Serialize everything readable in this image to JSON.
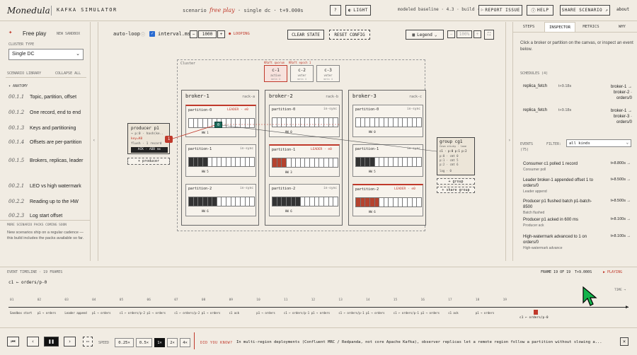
{
  "topbar": {
    "logo": "Monedula",
    "app_name": "KAFKA SIMULATOR",
    "scenario_prefix": "scenario",
    "scenario_name": "free play",
    "scenario_suffix": "· single dc · t+9.000s",
    "help_label": "?",
    "theme_label": "LIGHT",
    "build": "modeled baseline · 4.3 · build · 1.2.0",
    "report_issue": "REPORT ISSUE",
    "help": "HELP",
    "share": "SHARE SCENARIO ↗",
    "about": "about"
  },
  "left": {
    "tab_label": "Free play",
    "new_sandbox": "NEW SANDBOX",
    "cluster_type_label": "CLUSTER TYPE",
    "cluster_type_value": "Single DC",
    "library_label": "SCENARIO LIBRARY",
    "collapse_all": "COLLAPSE ALL",
    "section": "ANATOMY",
    "lessons": [
      {
        "num": "00.1.1",
        "title": "Topic, partition, offset"
      },
      {
        "num": "00.1.2",
        "title": "One record, end to end"
      },
      {
        "num": "00.1.3",
        "title": "Keys and partitioning"
      },
      {
        "num": "00.1.4",
        "title": "Offsets are per-partition"
      },
      {
        "num": "00.1.5",
        "title": "Brokers, replicas, leader"
      },
      {
        "num": "00.2.1",
        "title": "LEO vs high watermark"
      },
      {
        "num": "00.2.2",
        "title": "Reading up to the HW"
      },
      {
        "num": "00.2.3",
        "title": "Log start offset"
      }
    ],
    "packs_label": "MORE SCENARIO PACKS COMING SOON",
    "packs_desc": "New scenarios ship on a regular cadence — this build includes the packs available so far."
  },
  "canvas": {
    "autoloop": "auto-loop",
    "interval_label": "interval.ms",
    "interval_value": "1000",
    "looping": "LOOPING",
    "clear_state": "CLEAR STATE",
    "reset_config": "RESET CONFIG",
    "legend": "Legend",
    "zoom": "100%",
    "cluster_label": "Cluster",
    "quorum_label": "KRaft quorum",
    "epoch_label": "KRaft epoch 1",
    "controllers": [
      {
        "name": "c-1",
        "role": "active",
        "epoch": "meta 4"
      },
      {
        "name": "c-2",
        "role": "voter",
        "epoch": "meta 4"
      },
      {
        "name": "c-3",
        "role": "voter",
        "epoch": "meta 4"
      }
    ],
    "brokers": [
      {
        "name": "broker-1",
        "rack": "rack-a",
        "partitions": [
          {
            "name": "partition-0",
            "status": "in-sync",
            "leader": "LEADER · e0",
            "hw": "HW 1"
          },
          {
            "name": "partition-1",
            "status": "in-sync",
            "leader": "",
            "hw": "HW 5"
          },
          {
            "name": "partition-2",
            "status": "in-sync",
            "leader": "",
            "hw": "HW 6"
          }
        ]
      },
      {
        "name": "broker-2",
        "rack": "rack-b",
        "partitions": [
          {
            "name": "partition-0",
            "status": "in-sync",
            "leader": "",
            "hw": "HW 0"
          },
          {
            "name": "partition-1",
            "status": "in-sync",
            "leader": "LEADER · e0",
            "hw": "HW 3"
          },
          {
            "name": "partition-2",
            "status": "in-sync",
            "leader": "",
            "hw": "HW 6"
          }
        ]
      },
      {
        "name": "broker-3",
        "rack": "rack-c",
        "partitions": [
          {
            "name": "partition-0",
            "status": "in-sync",
            "leader": "",
            "hw": "HW 0"
          },
          {
            "name": "partition-1",
            "status": "in-sync",
            "leader": "",
            "hw": "HW 5"
          },
          {
            "name": "partition-2",
            "status": "in-sync",
            "leader": "LEADER · e0",
            "hw": "HW 6"
          }
        ]
      }
    ],
    "producer": {
      "name": "producer p1",
      "line1": "→ p:0 · hash(ke..",
      "key": "key=K0",
      "line2": "flush · 1 record",
      "ack": "ACK · ADD ms",
      "badge": "1"
    },
    "add_producer": "+ producer",
    "group": {
      "name": "group cg1",
      "line1": "Cnsm sticky · lane",
      "line2": "c1 · p:0 p:1 p:2",
      "l1": "p:0 · cmt 0",
      "l2": "p:1 · cmt 5",
      "l3": "p:2 · cmt 6",
      "lag": "lag · 0"
    },
    "add_group": "+ group",
    "share_group": "+ share group",
    "offset_marker": "0"
  },
  "right": {
    "tabs": [
      "STEPS",
      "INSPECTOR",
      "METRICS",
      "WHY"
    ],
    "hint": "Click a broker or partition on the canvas, or inspect an event below.",
    "schedules_label": "SCHEDULES (4)",
    "schedules": [
      {
        "name": "replica_fetch",
        "time": "t+9.18s",
        "target": "broker-1 → broker-2 · orders/0"
      },
      {
        "name": "replica_fetch",
        "time": "t+9.18s",
        "target": "broker-1 → broker-3 · orders/0"
      }
    ],
    "events_label": "EVENTS",
    "events_count": "(75)",
    "filter_label": "FILTER:",
    "filter_value": "all kinds",
    "events": [
      {
        "text": "Consumer c1 polled 1 record",
        "time": "t+8.800s →",
        "sub": "Consumer poll"
      },
      {
        "text": "Leader broker-1 appended offset 1 to orders/0",
        "time": "t+8.500s →",
        "sub": "Leader append"
      },
      {
        "text": "Producer p1 flushed batch p1-batch-8500",
        "time": "t+8.500s →",
        "sub": "Batch flushed"
      },
      {
        "text": "Producer p1 acked in 600 ms",
        "time": "t+8.100s →",
        "sub": "Producer ack"
      },
      {
        "text": "High-watermark advanced to 1 on orders/0",
        "time": "t+8.100s →",
        "sub": "High-watermark advance"
      }
    ]
  },
  "timeline": {
    "title": "EVENT TIMELINE · 19 FRAMES",
    "frame_label": "FRAME 19 OF 19",
    "time": "T+9.000S",
    "playing": "▶ PLAYING",
    "partition_label": "c1 ← orders/p-0",
    "time_axis": "TIME →",
    "frames": [
      "01",
      "02",
      "03",
      "04",
      "05",
      "06",
      "07",
      "08",
      "09",
      "10",
      "11",
      "12",
      "13",
      "14",
      "15",
      "16",
      "17",
      "18",
      "19"
    ],
    "events_row": [
      "Sandbox start",
      "p1 → orders",
      "Leader append",
      "p1 → orders",
      "c1 ← orders/p-2",
      "p1 → orders",
      "c1 ← orders/p-2",
      "p1 → orders",
      "c1 ack",
      "p1 → orders",
      "c1 ← orders/p-1",
      "p1 → orders",
      "c1 ← orders/p-1",
      "p1 → orders",
      "c1 ← orders/p-1",
      "p1 → orders",
      "c1 ack",
      "p1 → orders"
    ],
    "current_label": "c1 ← orders/p-0"
  },
  "bottom": {
    "speed_label": "SPEED",
    "speeds": [
      "0.25×",
      "0.5×",
      "1×",
      "2×",
      "4×"
    ],
    "tip_label": "DID YOU KNOW?",
    "tip": "In multi-region deployments (Confluent MRC / Redpanda, not core Apache Kafka), observer replicas let a remote region follow a partition without slowing a..."
  },
  "colors": {
    "accent": "#c0392b",
    "bg": "#f1ece3",
    "teal": "#1e6b5c"
  }
}
